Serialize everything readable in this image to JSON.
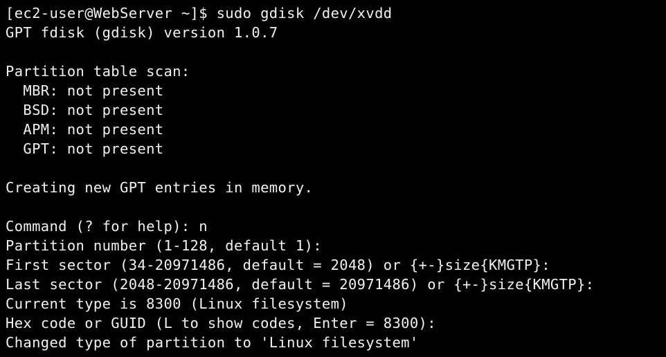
{
  "terminal": {
    "lines": [
      "[ec2-user@WebServer ~]$ sudo gdisk /dev/xvdd",
      "GPT fdisk (gdisk) version 1.0.7",
      "",
      "Partition table scan:",
      "  MBR: not present",
      "  BSD: not present",
      "  APM: not present",
      "  GPT: not present",
      "",
      "Creating new GPT entries in memory.",
      "",
      "Command (? for help): n",
      "Partition number (1-128, default 1):",
      "First sector (34-20971486, default = 2048) or {+-}size{KMGTP}:",
      "Last sector (2048-20971486, default = 20971486) or {+-}size{KMGTP}:",
      "Current type is 8300 (Linux filesystem)",
      "Hex code or GUID (L to show codes, Enter = 8300):",
      "Changed type of partition to 'Linux filesystem'"
    ]
  },
  "colors": {
    "background": "#000000",
    "foreground": "#f2f2f2"
  }
}
